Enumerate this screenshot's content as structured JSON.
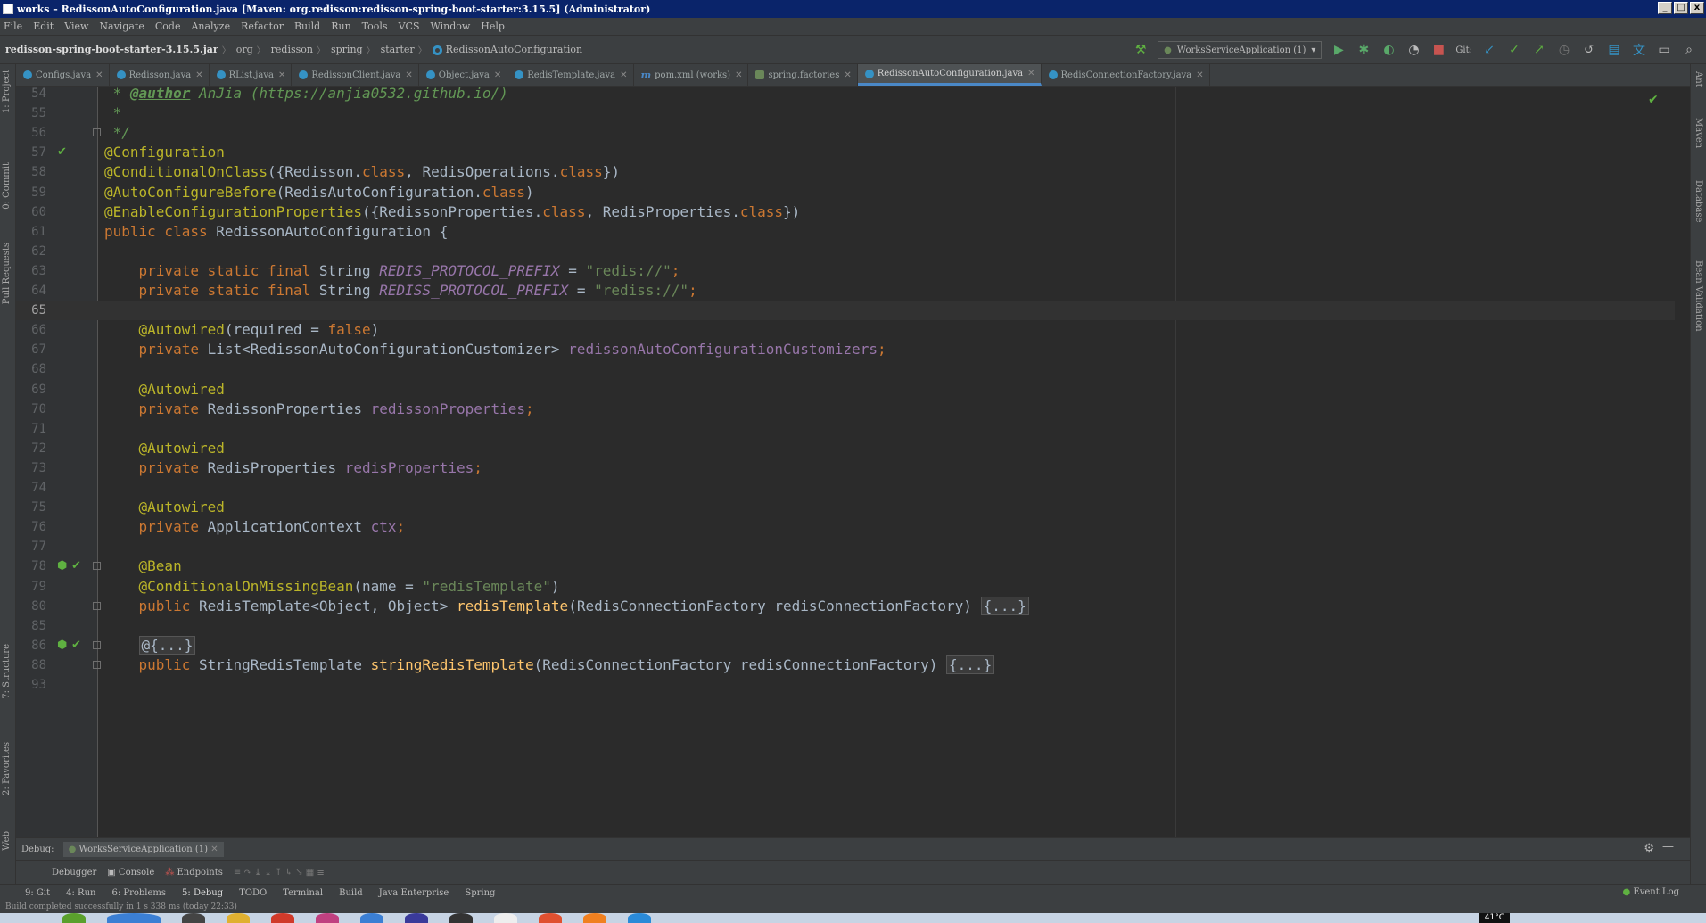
{
  "window": {
    "title": "works – RedissonAutoConfiguration.java [Maven: org.redisson:redisson-spring-boot-starter:3.15.5] (Administrator)",
    "min": "_",
    "max": "□",
    "close": "x"
  },
  "menu": [
    "File",
    "Edit",
    "View",
    "Navigate",
    "Code",
    "Analyze",
    "Refactor",
    "Build",
    "Run",
    "Tools",
    "VCS",
    "Window",
    "Help"
  ],
  "breadcrumb": {
    "jar": "redisson-spring-boot-starter-3.15.5.jar",
    "parts": [
      "org",
      "redisson",
      "spring",
      "starter"
    ],
    "file": "RedissonAutoConfiguration"
  },
  "toolbar": {
    "run_config": "WorksServiceApplication (1)",
    "git_label": "Git:"
  },
  "tabs": [
    {
      "label": "Configs.java",
      "icon": "class-icon",
      "active": false
    },
    {
      "label": "Redisson.java",
      "icon": "class-icon",
      "active": false
    },
    {
      "label": "RList.java",
      "icon": "class-icon",
      "active": false
    },
    {
      "label": "RedissonClient.java",
      "icon": "class-icon",
      "active": false
    },
    {
      "label": "Object.java",
      "icon": "class-icon",
      "active": false
    },
    {
      "label": "RedisTemplate.java",
      "icon": "class-icon",
      "active": false
    },
    {
      "label": "pom.xml (works)",
      "icon": "maven-icon",
      "active": false
    },
    {
      "label": "spring.factories",
      "icon": "spring-icon",
      "active": false
    },
    {
      "label": "RedissonAutoConfiguration.java",
      "icon": "class-icon",
      "active": true
    },
    {
      "label": "RedisConnectionFactory.java",
      "icon": "class-icon",
      "active": false
    }
  ],
  "editor": {
    "current_line": "65",
    "lines": [
      {
        "n": "54",
        "t": [
          [
            "c-doc",
            " * "
          ],
          [
            "c-doctag",
            "@author"
          ],
          [
            "c-doc",
            " AnJia (https://anjia0532.github.io/)"
          ]
        ]
      },
      {
        "n": "55",
        "t": [
          [
            "c-doc",
            " *"
          ]
        ]
      },
      {
        "n": "56",
        "t": [
          [
            "c-doc",
            " */"
          ]
        ]
      },
      {
        "n": "57",
        "t": [
          [
            "c-ann",
            "@Configuration"
          ]
        ]
      },
      {
        "n": "58",
        "t": [
          [
            "c-ann",
            "@ConditionalOnClass"
          ],
          [
            "c-plain",
            "({Redisson."
          ],
          [
            "c-kw",
            "class"
          ],
          [
            "c-plain",
            ", RedisOperations."
          ],
          [
            "c-kw",
            "class"
          ],
          [
            "c-plain",
            "})"
          ]
        ]
      },
      {
        "n": "59",
        "t": [
          [
            "c-ann",
            "@AutoConfigureBefore"
          ],
          [
            "c-plain",
            "(RedisAutoConfiguration."
          ],
          [
            "c-kw",
            "class"
          ],
          [
            "c-plain",
            ")"
          ]
        ]
      },
      {
        "n": "60",
        "t": [
          [
            "c-ann",
            "@EnableConfigurationProperties"
          ],
          [
            "c-plain",
            "({RedissonProperties."
          ],
          [
            "c-kw",
            "class"
          ],
          [
            "c-plain",
            ", RedisProperties."
          ],
          [
            "c-kw",
            "class"
          ],
          [
            "c-plain",
            "})"
          ]
        ]
      },
      {
        "n": "61",
        "t": [
          [
            "c-kw",
            "public class "
          ],
          [
            "c-plain",
            "RedissonAutoConfiguration {"
          ]
        ]
      },
      {
        "n": "62",
        "t": []
      },
      {
        "n": "63",
        "t": [
          [
            "c-plain",
            "    "
          ],
          [
            "c-kw",
            "private static final "
          ],
          [
            "c-plain",
            "String "
          ],
          [
            "c-const",
            "REDIS_PROTOCOL_PREFIX"
          ],
          [
            "c-plain",
            " = "
          ],
          [
            "c-str",
            "\"redis://\""
          ],
          [
            "c-kw",
            ";"
          ]
        ]
      },
      {
        "n": "64",
        "t": [
          [
            "c-plain",
            "    "
          ],
          [
            "c-kw",
            "private static final "
          ],
          [
            "c-plain",
            "String "
          ],
          [
            "c-const",
            "REDISS_PROTOCOL_PREFIX"
          ],
          [
            "c-plain",
            " = "
          ],
          [
            "c-str",
            "\"rediss://\""
          ],
          [
            "c-kw",
            ";"
          ]
        ]
      },
      {
        "n": "65",
        "t": []
      },
      {
        "n": "66",
        "t": [
          [
            "c-plain",
            "    "
          ],
          [
            "c-ann",
            "@Autowired"
          ],
          [
            "c-plain",
            "(required = "
          ],
          [
            "c-kw",
            "false"
          ],
          [
            "c-plain",
            ")"
          ]
        ]
      },
      {
        "n": "67",
        "t": [
          [
            "c-plain",
            "    "
          ],
          [
            "c-kw",
            "private "
          ],
          [
            "c-plain",
            "List<RedissonAutoConfigurationCustomizer> "
          ],
          [
            "c-field",
            "redissonAutoConfigurationCustomizers"
          ],
          [
            "c-kw",
            ";"
          ]
        ]
      },
      {
        "n": "68",
        "t": []
      },
      {
        "n": "69",
        "t": [
          [
            "c-plain",
            "    "
          ],
          [
            "c-ann",
            "@Autowired"
          ]
        ]
      },
      {
        "n": "70",
        "t": [
          [
            "c-plain",
            "    "
          ],
          [
            "c-kw",
            "private "
          ],
          [
            "c-plain",
            "RedissonProperties "
          ],
          [
            "c-field",
            "redissonProperties"
          ],
          [
            "c-kw",
            ";"
          ]
        ]
      },
      {
        "n": "71",
        "t": []
      },
      {
        "n": "72",
        "t": [
          [
            "c-plain",
            "    "
          ],
          [
            "c-ann",
            "@Autowired"
          ]
        ]
      },
      {
        "n": "73",
        "t": [
          [
            "c-plain",
            "    "
          ],
          [
            "c-kw",
            "private "
          ],
          [
            "c-plain",
            "RedisProperties "
          ],
          [
            "c-field",
            "redisProperties"
          ],
          [
            "c-kw",
            ";"
          ]
        ]
      },
      {
        "n": "74",
        "t": []
      },
      {
        "n": "75",
        "t": [
          [
            "c-plain",
            "    "
          ],
          [
            "c-ann",
            "@Autowired"
          ]
        ]
      },
      {
        "n": "76",
        "t": [
          [
            "c-plain",
            "    "
          ],
          [
            "c-kw",
            "private "
          ],
          [
            "c-plain",
            "ApplicationContext "
          ],
          [
            "c-field",
            "ctx"
          ],
          [
            "c-kw",
            ";"
          ]
        ]
      },
      {
        "n": "77",
        "t": []
      },
      {
        "n": "78",
        "t": [
          [
            "c-plain",
            "    "
          ],
          [
            "c-ann",
            "@Bean"
          ]
        ]
      },
      {
        "n": "79",
        "t": [
          [
            "c-plain",
            "    "
          ],
          [
            "c-ann",
            "@ConditionalOnMissingBean"
          ],
          [
            "c-plain",
            "(name = "
          ],
          [
            "c-str",
            "\"redisTemplate\""
          ],
          [
            "c-plain",
            ")"
          ]
        ]
      },
      {
        "n": "80",
        "t": [
          [
            "c-plain",
            "    "
          ],
          [
            "c-kw",
            "public "
          ],
          [
            "c-plain",
            "RedisTemplate<Object, Object> "
          ],
          [
            "c-method",
            "redisTemplate"
          ],
          [
            "c-plain",
            "(RedisConnectionFactory redisConnectionFactory) "
          ],
          [
            "c-fold",
            "{...}"
          ]
        ]
      },
      {
        "n": "85",
        "t": []
      },
      {
        "n": "86",
        "t": [
          [
            "c-plain",
            "    "
          ],
          [
            "c-fold",
            "@{...}"
          ]
        ]
      },
      {
        "n": "88",
        "t": [
          [
            "c-plain",
            "    "
          ],
          [
            "c-kw",
            "public "
          ],
          [
            "c-plain",
            "StringRedisTemplate "
          ],
          [
            "c-method",
            "stringRedisTemplate"
          ],
          [
            "c-plain",
            "(RedisConnectionFactory redisConnectionFactory) "
          ],
          [
            "c-fold",
            "{...}"
          ]
        ]
      },
      {
        "n": "93",
        "t": []
      }
    ]
  },
  "debug": {
    "label": "Debug:",
    "session": "WorksServiceApplication (1)",
    "tabs": [
      "Debugger",
      "Console",
      "Endpoints"
    ]
  },
  "bottom_tools": [
    "9: Git",
    "4: Run",
    "6: Problems",
    "5: Debug",
    "TODO",
    "Terminal",
    "Build",
    "Java Enterprise",
    "Spring"
  ],
  "event_log": "Event Log",
  "left_tools": [
    "1: Project",
    "0: Commit",
    "Pull Requests",
    "7: Structure",
    "2: Favorites",
    "Web"
  ],
  "right_tools": [
    "Ant",
    "Maven",
    "Database",
    "Bean Validation"
  ],
  "status": "Build completed successfully in 1 s 338 ms (today 22:33)",
  "taskbar": {
    "temp": "41°C"
  },
  "colors": {
    "accent": "#4a88c7",
    "keyword": "#cc7832",
    "annotation": "#bbb529",
    "string": "#6a8759",
    "field": "#9876aa",
    "method": "#ffc66d"
  }
}
